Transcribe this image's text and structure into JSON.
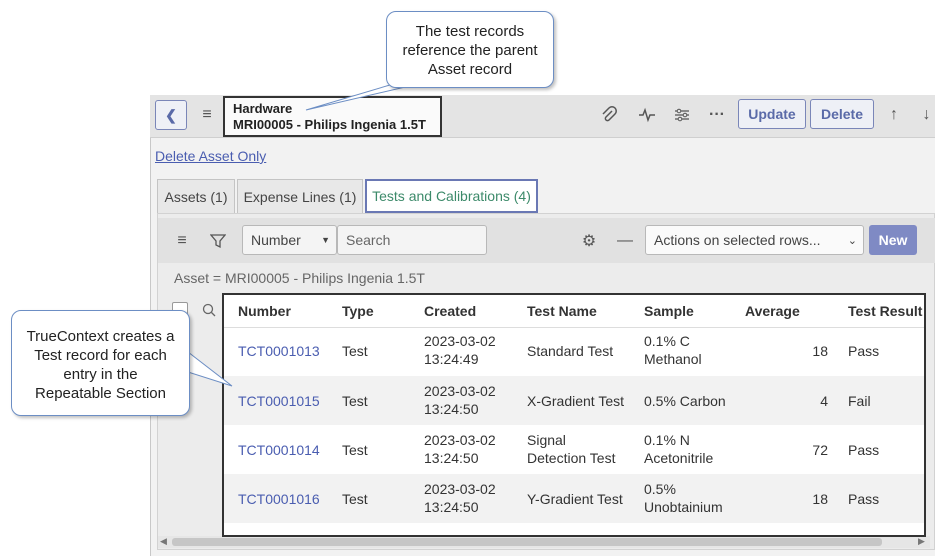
{
  "header": {
    "record_type": "Hardware",
    "record_name": "MRI00005 - Philips Ingenia 1.5T",
    "update_label": "Update",
    "delete_label": "Delete"
  },
  "delete_asset_only": "Delete Asset Only",
  "tabs": [
    {
      "label": "Assets (1)"
    },
    {
      "label": "Expense Lines (1)"
    },
    {
      "label": "Tests and Calibrations (4)"
    }
  ],
  "list_toolbar": {
    "field_select": "Number",
    "search_placeholder": "Search",
    "actions_select": "Actions on selected rows...",
    "new_label": "New"
  },
  "breadcrumb": "Asset = MRI00005 - Philips Ingenia 1.5T",
  "table": {
    "columns": [
      "Number",
      "Type",
      "Created",
      "Test Name",
      "Sample",
      "Average",
      "Test Result"
    ],
    "rows": [
      {
        "number": "TCT0001013",
        "type": "Test",
        "created_date": "2023-03-02",
        "created_time": "13:24:49",
        "test_name_1": "Standard Test",
        "test_name_2": "",
        "sample_1": "0.1% C",
        "sample_2": "Methanol",
        "average": "18",
        "result": "Pass"
      },
      {
        "number": "TCT0001015",
        "type": "Test",
        "created_date": "2023-03-02",
        "created_time": "13:24:50",
        "test_name_1": "X-Gradient Test",
        "test_name_2": "",
        "sample_1": "0.5% Carbon",
        "sample_2": "",
        "average": "4",
        "result": "Fail"
      },
      {
        "number": "TCT0001014",
        "type": "Test",
        "created_date": "2023-03-02",
        "created_time": "13:24:50",
        "test_name_1": "Signal",
        "test_name_2": "Detection Test",
        "sample_1": "0.1% N",
        "sample_2": "Acetonitrile",
        "average": "72",
        "result": "Pass"
      },
      {
        "number": "TCT0001016",
        "type": "Test",
        "created_date": "2023-03-02",
        "created_time": "13:24:50",
        "test_name_1": "Y-Gradient Test",
        "test_name_2": "",
        "sample_1": "0.5%",
        "sample_2": "Unobtainium",
        "average": "18",
        "result": "Pass"
      }
    ]
  },
  "callouts": {
    "top_line1": "The test records",
    "top_line2": "reference the parent",
    "top_line3": "Asset record",
    "left_line1": "TrueContext creates a",
    "left_line2": "Test record for each",
    "left_line3": "entry in the",
    "left_line4": "Repeatable Section"
  },
  "icons": [
    "back-icon",
    "menu-icon",
    "paperclip-icon",
    "activity-icon",
    "sliders-icon",
    "more-icon",
    "arrow-up-icon",
    "arrow-down-icon",
    "filter-icon",
    "gear-icon",
    "minus-icon",
    "search-icon"
  ],
  "colors": {
    "accent": "#6a78b4",
    "link": "#4a5db0",
    "active_tab_text": "#3c8a6a",
    "new_button": "#7f8ac4"
  }
}
